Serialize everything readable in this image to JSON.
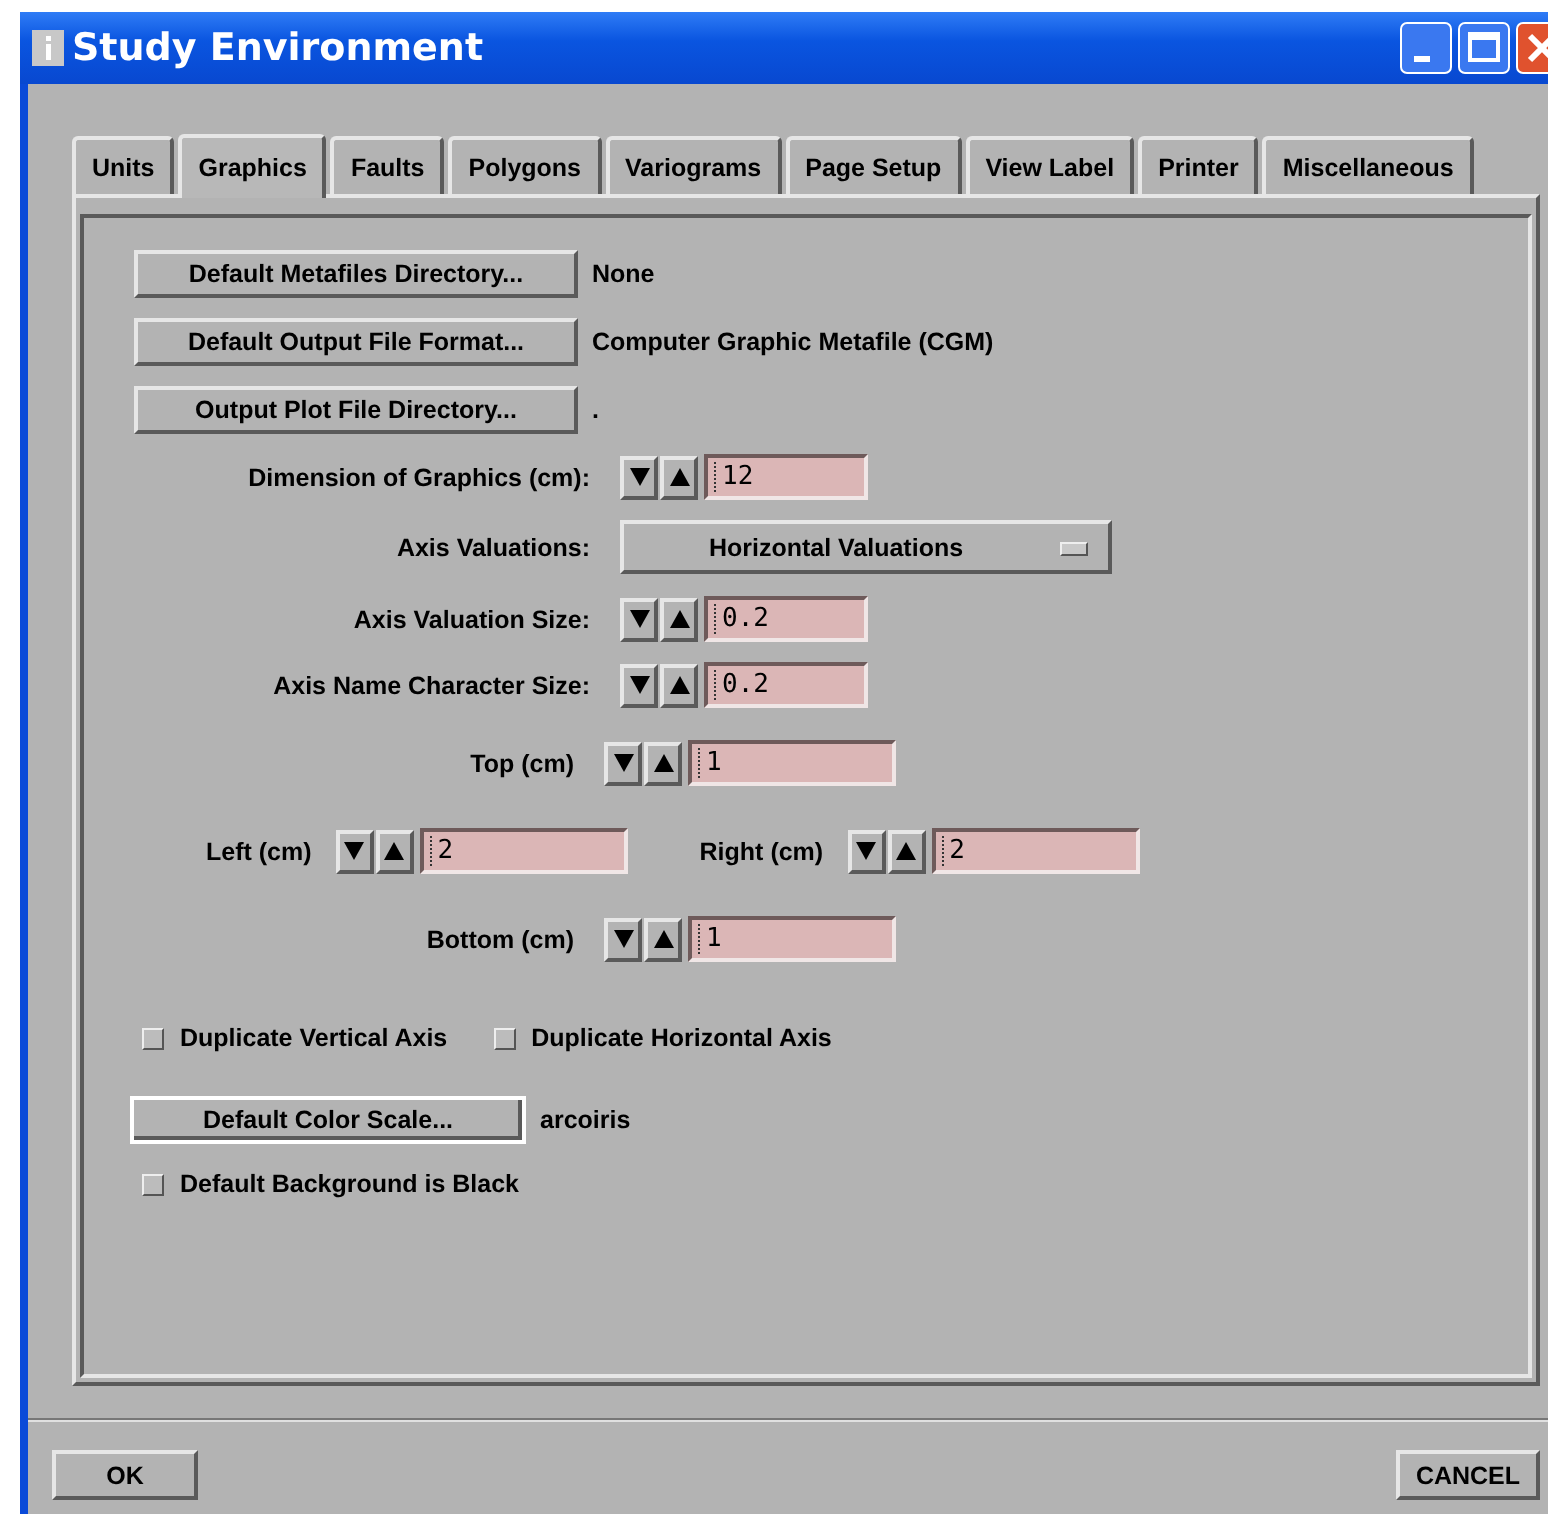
{
  "window": {
    "title": "Study Environment"
  },
  "tabs": [
    {
      "label": "Units",
      "selected": false
    },
    {
      "label": "Graphics",
      "selected": true
    },
    {
      "label": "Faults",
      "selected": false
    },
    {
      "label": "Polygons",
      "selected": false
    },
    {
      "label": "Variograms",
      "selected": false
    },
    {
      "label": "Page Setup",
      "selected": false
    },
    {
      "label": "View Label",
      "selected": false
    },
    {
      "label": "Printer",
      "selected": false
    },
    {
      "label": "Miscellaneous",
      "selected": false
    }
  ],
  "directory_buttons": [
    {
      "label": "Default Metafiles Directory...",
      "value": "None"
    },
    {
      "label": "Default Output File Format...",
      "value": "Computer Graphic Metafile (CGM)"
    },
    {
      "label": "Output Plot File Directory...",
      "value": "."
    }
  ],
  "settings": [
    {
      "kind": "spin",
      "label": "Dimension of Graphics (cm):",
      "value": "12"
    },
    {
      "kind": "dropdown",
      "label": "Axis Valuations:",
      "value": "Horizontal Valuations"
    },
    {
      "kind": "spin",
      "label": "Axis Valuation Size:",
      "value": "0.2"
    },
    {
      "kind": "spin",
      "label": "Axis Name Character Size:",
      "value": "0.2"
    }
  ],
  "margins": {
    "top": {
      "label": "Top (cm)",
      "value": "1"
    },
    "left": {
      "label": "Left (cm)",
      "value": "2"
    },
    "right": {
      "label": "Right (cm)",
      "value": "2"
    },
    "bottom": {
      "label": "Bottom (cm)",
      "value": "1"
    }
  },
  "axis_options": [
    {
      "label": "Duplicate Vertical Axis",
      "checked": false
    },
    {
      "label": "Duplicate Horizontal Axis",
      "checked": false
    }
  ],
  "color_scale": {
    "button": "Default Color Scale...",
    "value": "arcoiris"
  },
  "background_option": {
    "label": "Default Background is Black",
    "checked": false
  },
  "buttons": [
    {
      "label": "OK"
    },
    {
      "label": "CANCEL"
    }
  ]
}
